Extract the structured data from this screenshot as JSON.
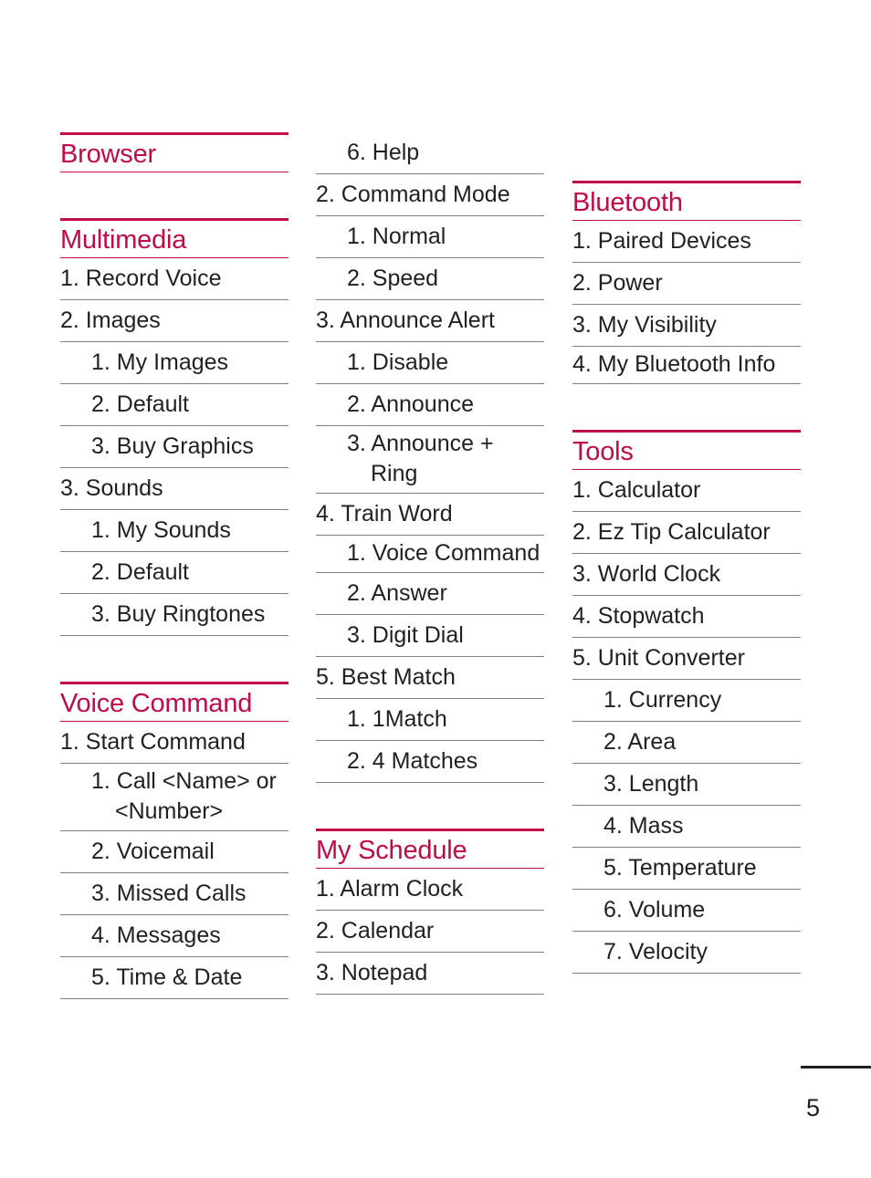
{
  "document": {
    "page_number": "5",
    "accent_color": "#C10A4A",
    "text_color": "#231f20",
    "rule_color": "#808080"
  },
  "columns": [
    {
      "id": "column-1",
      "sections": [
        {
          "title": "Browser",
          "items": []
        },
        {
          "title": "Multimedia",
          "items": [
            {
              "text": "1. Record Voice",
              "level": 1
            },
            {
              "text": "2. Images",
              "level": 1
            },
            {
              "text": "1. My Images",
              "level": 2
            },
            {
              "text": "2. Default",
              "level": 2
            },
            {
              "text": "3. Buy Graphics",
              "level": 2
            },
            {
              "text": "3. Sounds",
              "level": 1
            },
            {
              "text": "1. My Sounds",
              "level": 2
            },
            {
              "text": "2. Default",
              "level": 2
            },
            {
              "text": "3. Buy Ringtones",
              "level": 2
            }
          ]
        },
        {
          "title": "Voice Command",
          "items": [
            {
              "text": "1. Start Command",
              "level": 1
            },
            {
              "text": "1. Call <Name> or <Number>",
              "level": 2,
              "wrap": true
            },
            {
              "text": "2. Voicemail",
              "level": 2
            },
            {
              "text": "3. Missed Calls",
              "level": 2
            },
            {
              "text": "4. Messages",
              "level": 2
            },
            {
              "text": "5. Time & Date",
              "level": 2
            }
          ]
        }
      ]
    },
    {
      "id": "column-2",
      "sections": [
        {
          "title": "",
          "items": [
            {
              "text": "6. Help",
              "level": 2
            },
            {
              "text": "2. Command Mode",
              "level": 1
            },
            {
              "text": "1. Normal",
              "level": 2
            },
            {
              "text": "2. Speed",
              "level": 2
            },
            {
              "text": "3. Announce Alert",
              "level": 1
            },
            {
              "text": "1. Disable",
              "level": 2
            },
            {
              "text": "2. Announce",
              "level": 2
            },
            {
              "text": "3. Announce + Ring",
              "level": 2,
              "wrap": true
            },
            {
              "text": "4. Train Word",
              "level": 1
            },
            {
              "text": "1. Voice Command",
              "level": 2,
              "wrap": true
            },
            {
              "text": "2. Answer",
              "level": 2
            },
            {
              "text": "3. Digit Dial",
              "level": 2
            },
            {
              "text": "5. Best Match",
              "level": 1
            },
            {
              "text": "1. 1Match",
              "level": 2
            },
            {
              "text": "2. 4 Matches",
              "level": 2
            }
          ]
        },
        {
          "title": "My Schedule",
          "items": [
            {
              "text": "1. Alarm Clock",
              "level": 1
            },
            {
              "text": "2. Calendar",
              "level": 1
            },
            {
              "text": "3. Notepad",
              "level": 1
            }
          ]
        }
      ]
    },
    {
      "id": "column-3",
      "sections": [
        {
          "title": "Bluetooth",
          "items": [
            {
              "text": "1. Paired Devices",
              "level": 1
            },
            {
              "text": "2. Power",
              "level": 1
            },
            {
              "text": "3. My Visibility",
              "level": 1
            },
            {
              "text": "4. My Bluetooth Info",
              "level": 1,
              "wrap": true
            }
          ]
        },
        {
          "title": "Tools",
          "items": [
            {
              "text": "1. Calculator",
              "level": 1
            },
            {
              "text": "2. Ez Tip Calculator",
              "level": 1
            },
            {
              "text": "3. World Clock",
              "level": 1
            },
            {
              "text": "4. Stopwatch",
              "level": 1
            },
            {
              "text": "5. Unit Converter",
              "level": 1
            },
            {
              "text": "1. Currency",
              "level": 2
            },
            {
              "text": "2. Area",
              "level": 2
            },
            {
              "text": "3. Length",
              "level": 2
            },
            {
              "text": "4. Mass",
              "level": 2
            },
            {
              "text": "5. Temperature",
              "level": 2
            },
            {
              "text": "6. Volume",
              "level": 2
            },
            {
              "text": "7. Velocity",
              "level": 2
            }
          ]
        }
      ]
    }
  ]
}
